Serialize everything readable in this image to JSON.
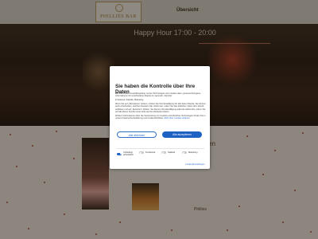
{
  "site": {
    "logo_text": "PHILLIES BAR",
    "nav_link": "Übersicht",
    "hero_title": "Happy Hour 17:00 - 20:00",
    "side_heading": "en",
    "right_text": "Phillies"
  },
  "consent": {
    "title": "Sie haben die Kontrolle über Ihre Daten",
    "paragraphs": [
      "Wir und unsere Geschäftspartner nutzen Technologien wie Cookies dazu, personenbezogene Informationen für verschiedene Zwecke zu sammeln, darunter:",
      "Funktional, Statistik, Marketing",
      "Wenn Sie auf „Akzeptieren“ klicken, erteilen Sie Ihre Einwilligung für alle diese Zwecke. Sie können auch entscheiden, welchen Zwecken Sie zustimmen, indem Sie das Kästchen neben dem Zweck anklicken und auf „Speichern“ klicken. Sie können Ihre Einwilligung jederzeit widerrufen, indem Sie auf das kleine Symbol unten links auf der Webseite klicken.",
      "Weitere Informationen über die Verwendung von Cookies und ähnlichen Technologien finden Sie in unserer Datenschutzerklärung und Cookie-Richtlinie."
    ],
    "more_link": "Mehr über Cookies erfahren",
    "reject_label": "Alle ablehnen",
    "accept_label": "Alle akzeptieren",
    "toggles": [
      {
        "label": "Unbedingt erforderlich",
        "on": true
      },
      {
        "label": "Funktional",
        "on": false
      },
      {
        "label": "Statistik",
        "on": false
      },
      {
        "label": "Marketing",
        "on": false
      }
    ],
    "details_link": "Cookie-Einstellungen"
  }
}
